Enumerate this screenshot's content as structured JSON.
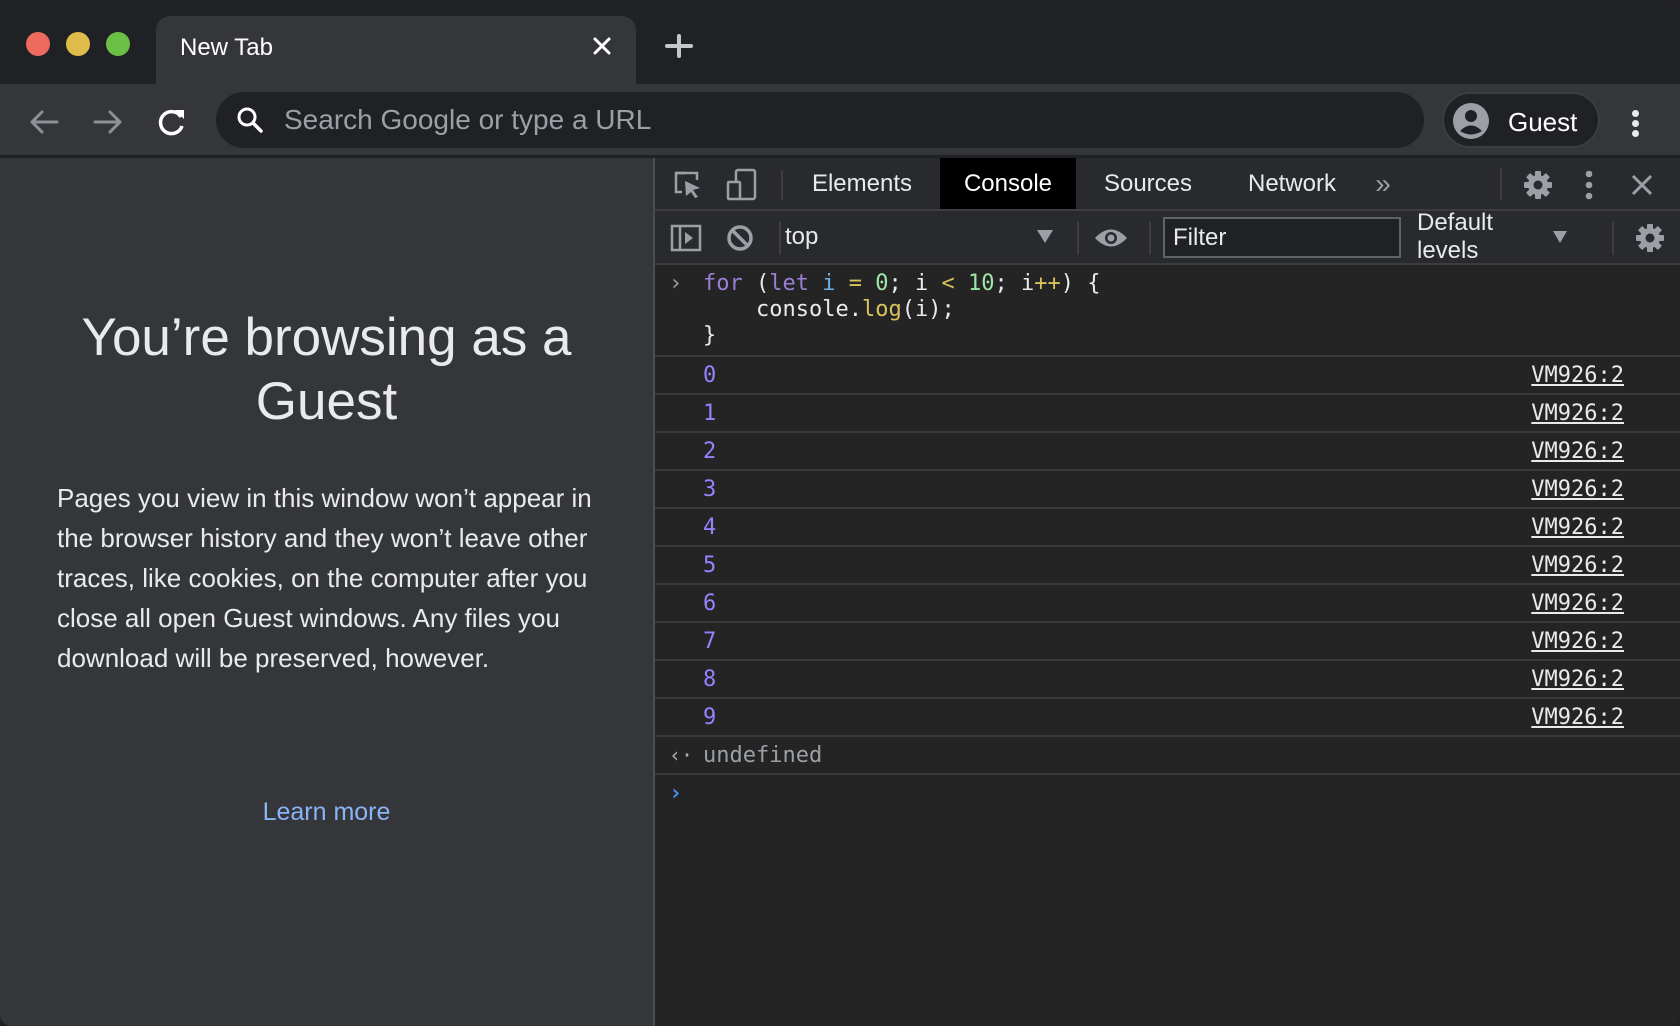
{
  "window": {
    "traffic_lights": {
      "close": "#ed6a5e",
      "minimize": "#e0bd4b",
      "maximize": "#6bbf47"
    }
  },
  "tabs": [
    {
      "title": "New Tab",
      "active": true
    }
  ],
  "toolbar": {
    "omnibox_placeholder": "Search Google or type a URL",
    "profile_label": "Guest"
  },
  "page": {
    "title": "You’re browsing as a Guest",
    "body": "Pages you view in this window won’t appear in the browser history and they won’t leave other traces, like cookies, on the computer after you close all open Guest windows. Any files you download will be preserved, however.",
    "learn_more": "Learn more",
    "link_color": "#8ab4f8"
  },
  "devtools": {
    "tabs": [
      {
        "label": "Elements",
        "active": false
      },
      {
        "label": "Console",
        "active": true
      },
      {
        "label": "Sources",
        "active": false
      },
      {
        "label": "Network",
        "active": false
      }
    ],
    "console_bar": {
      "context": "top",
      "filter_placeholder": "Filter",
      "levels": "Default levels"
    },
    "input": {
      "line1": {
        "kw1": "for",
        "p1": " (",
        "kw2": "let",
        "sp1": " ",
        "var": "i",
        "sp2": " ",
        "eq": "=",
        "sp3": " ",
        "n0": "0",
        "p2": "; i ",
        "lt": "<",
        "sp4": " ",
        "n10": "10",
        "p3": "; i",
        "inc": "++",
        "p4": ") {"
      },
      "line2": {
        "obj": "    console.",
        "fn": "log",
        "args": "(i);"
      },
      "line3": "}"
    },
    "logs": [
      {
        "value": "0",
        "source": "VM926:2"
      },
      {
        "value": "1",
        "source": "VM926:2"
      },
      {
        "value": "2",
        "source": "VM926:2"
      },
      {
        "value": "3",
        "source": "VM926:2"
      },
      {
        "value": "4",
        "source": "VM926:2"
      },
      {
        "value": "5",
        "source": "VM926:2"
      },
      {
        "value": "6",
        "source": "VM926:2"
      },
      {
        "value": "7",
        "source": "VM926:2"
      },
      {
        "value": "8",
        "source": "VM926:2"
      },
      {
        "value": "9",
        "source": "VM926:2"
      }
    ],
    "result": "undefined",
    "glyphs": {
      "prompt": "›",
      "result": "‹·",
      "close": "✕",
      "more_tabs": "»"
    }
  }
}
